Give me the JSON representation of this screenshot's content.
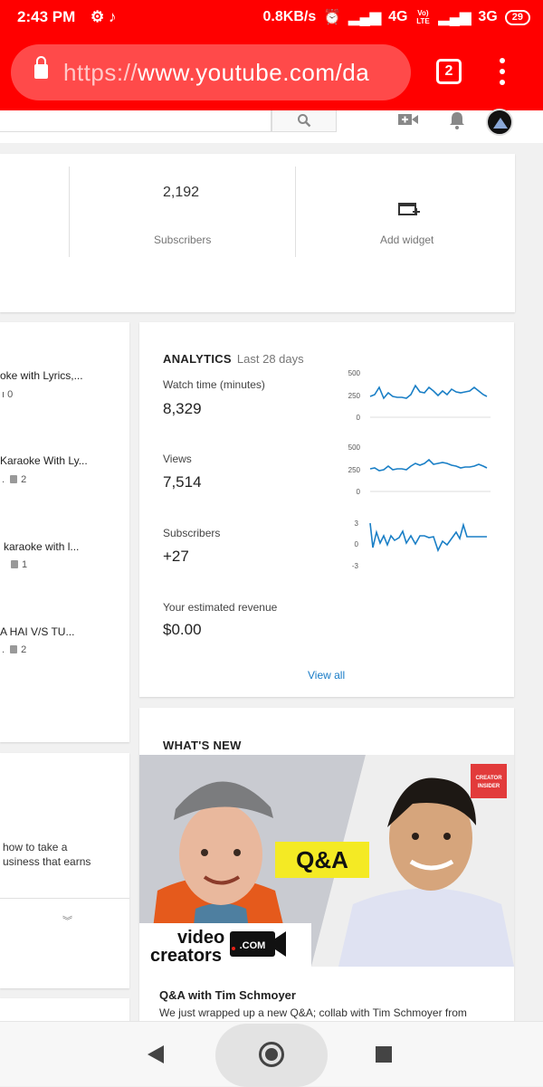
{
  "status_bar": {
    "time": "2:43 PM",
    "speed": "0.8KB/s",
    "network1": "4G",
    "volte": "Vo) LTE",
    "network2": "3G",
    "battery": "29"
  },
  "browser": {
    "url_scheme": "https://",
    "url_rest": "www.youtube.com/da",
    "tab_count": "2"
  },
  "stats": {
    "subscribers_value": "2,192",
    "subscribers_label": "Subscribers",
    "add_widget_label": "Add widget"
  },
  "videos": [
    {
      "title": "oke with Lyrics,...",
      "dislikes": "0"
    },
    {
      "title": "Karaoke With Ly...",
      "dislikes": "2"
    },
    {
      "title": "karaoke with l...",
      "dislikes": "1"
    },
    {
      "title": "A HAI V/S TU...",
      "dislikes": "2"
    }
  ],
  "analytics": {
    "heading": "ANALYTICS",
    "period": "Last 28 days",
    "metrics": [
      {
        "label": "Watch time (minutes)",
        "value": "8,329",
        "axis": [
          "500",
          "250",
          "0"
        ]
      },
      {
        "label": "Views",
        "value": "7,514",
        "axis": [
          "500",
          "250",
          "0"
        ]
      },
      {
        "label": "Subscribers",
        "value": "+27",
        "axis": [
          "3",
          "0",
          "-3"
        ]
      },
      {
        "label": "Your estimated revenue",
        "value": "$0.00"
      }
    ],
    "view_all": "View all"
  },
  "left_card2": {
    "line1": "how to take a",
    "line2": "usiness that earns"
  },
  "whats_new": {
    "heading": "WHAT'S NEW",
    "badge_line1": "CREATOR",
    "badge_line2": "INSIDER",
    "qa_label": "Q&A",
    "brand_line1": "video",
    "brand_line2": "creators",
    "brand_com": ".COM",
    "title": "Q&A with Tim Schmoyer",
    "description": "We just wrapped up a new Q&A; collab with Tim Schmoyer from"
  },
  "colors": {
    "brand_red": "#ff0000",
    "spark_line": "#1a7fc6",
    "link": "#167ac6"
  }
}
